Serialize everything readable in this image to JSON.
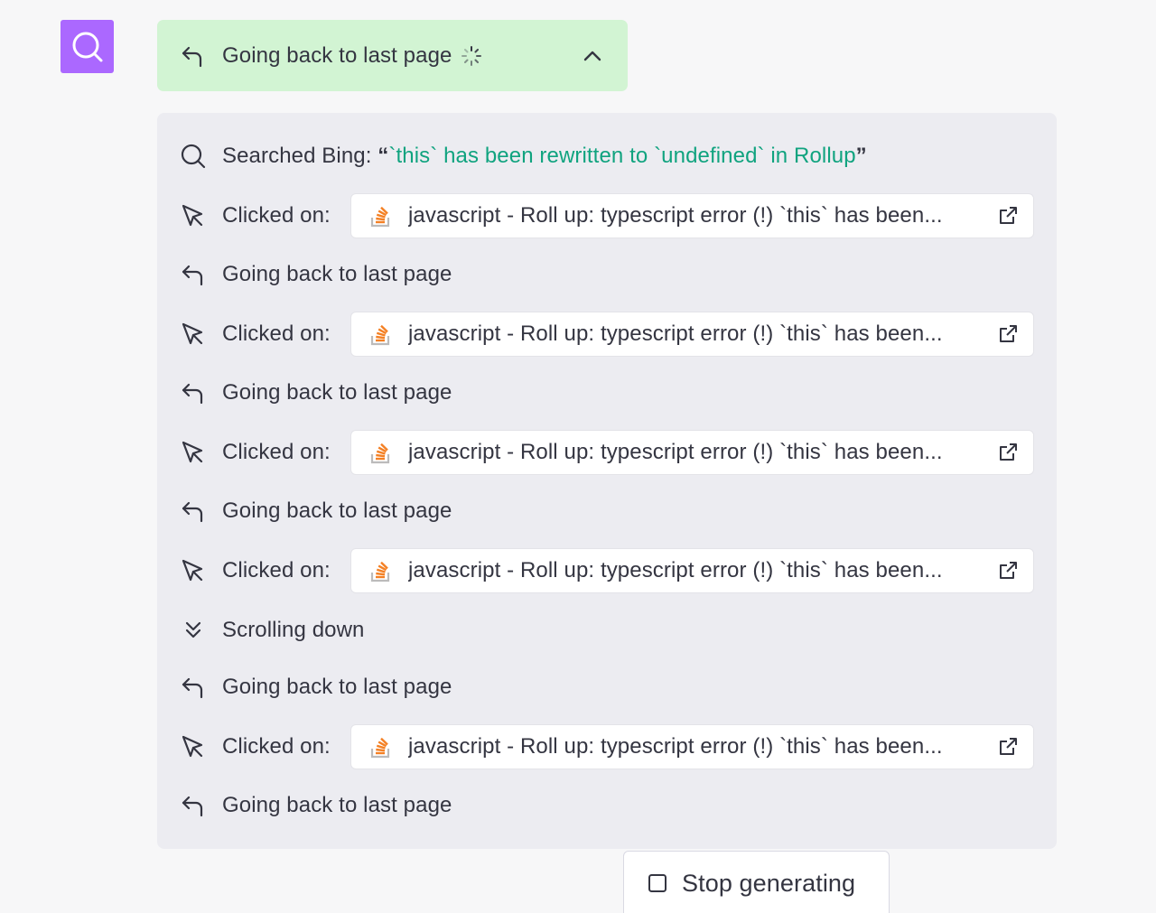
{
  "avatar": {
    "icon": "search-icon",
    "color": "#ab68ff"
  },
  "status": {
    "label": "Going back to last page",
    "icon": "return-arrow-icon",
    "spinner_icon": "loading-spinner-icon",
    "toggle_icon": "chevron-up-icon",
    "background": "#d2f4d3"
  },
  "steps": {
    "search": {
      "prefix": "Searched Bing: ",
      "open_quote": "“",
      "query": "`this` has been rewritten to `undefined` in Rollup",
      "close_quote": "”"
    },
    "items": [
      {
        "type": "click",
        "label": "Clicked on:",
        "link": "javascript - Roll up: typescript error (!) `this` has been..."
      },
      {
        "type": "back",
        "label": "Going back to last page"
      },
      {
        "type": "click",
        "label": "Clicked on:",
        "link": "javascript - Roll up: typescript error (!) `this` has been..."
      },
      {
        "type": "back",
        "label": "Going back to last page"
      },
      {
        "type": "click",
        "label": "Clicked on:",
        "link": "javascript - Roll up: typescript error (!) `this` has been..."
      },
      {
        "type": "back",
        "label": "Going back to last page"
      },
      {
        "type": "click",
        "label": "Clicked on:",
        "link": "javascript - Roll up: typescript error (!) `this` has been..."
      },
      {
        "type": "scroll",
        "label": "Scrolling down"
      },
      {
        "type": "back",
        "label": "Going back to last page"
      },
      {
        "type": "click",
        "label": "Clicked on:",
        "link": "javascript - Roll up: typescript error (!) `this` has been..."
      },
      {
        "type": "back",
        "label": "Going back to last page"
      }
    ]
  },
  "stop_button": {
    "label": "Stop generating",
    "icon": "stop-square-icon"
  },
  "colors": {
    "accent_green": "#10a37f",
    "stackoverflow_orange": "#f48024"
  }
}
